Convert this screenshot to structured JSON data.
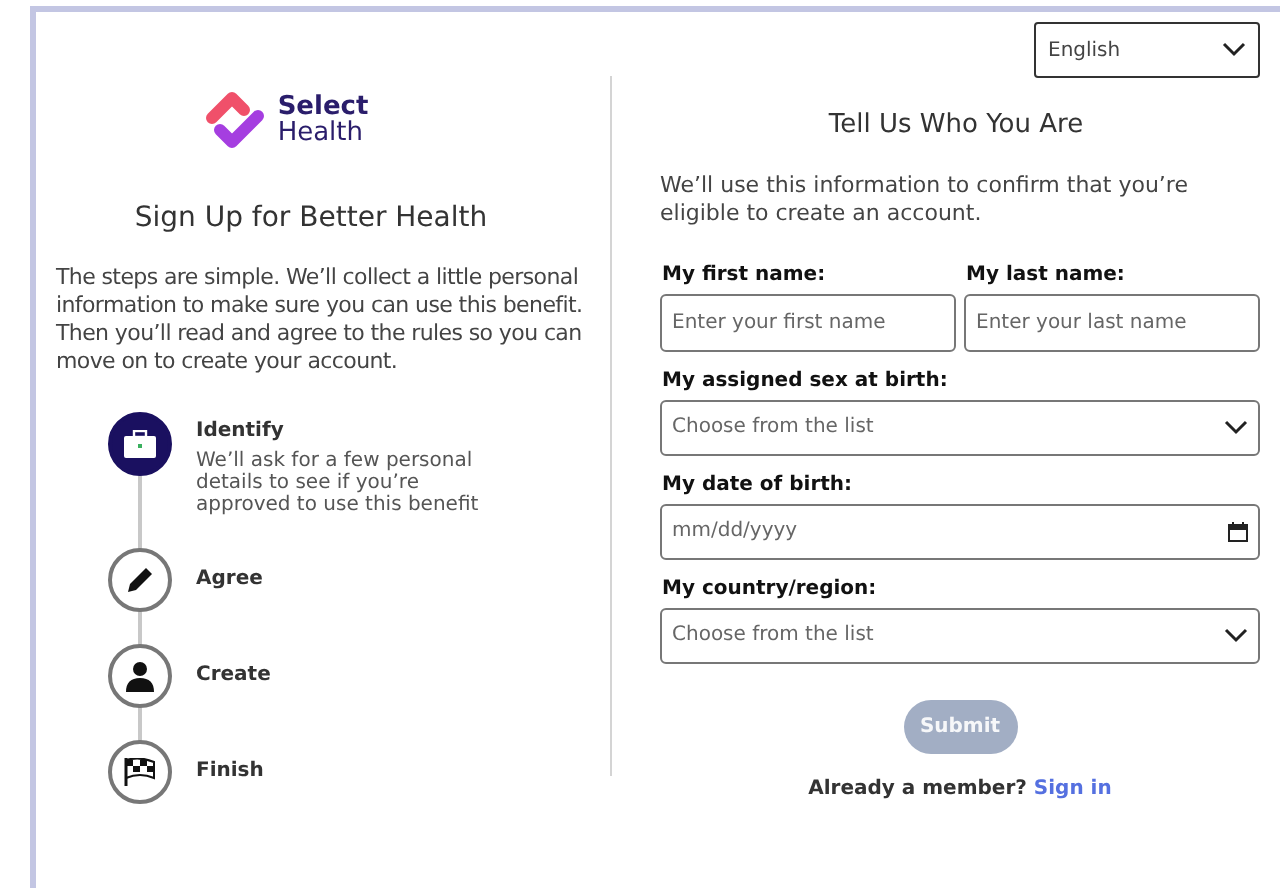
{
  "language": {
    "value": "English"
  },
  "brand": {
    "line1": "Select",
    "line2": "Health"
  },
  "intro": {
    "title": "Sign Up for Better Health",
    "text": "The steps are simple. We’ll collect a little personal information to make sure you can use this benefit. Then you’ll read and agree to the rules so you can move on to  create your account."
  },
  "steps": [
    {
      "kind": "briefcase",
      "label": "Identify",
      "detail": "We’ll ask for a few personal details to see if you’re approved to use this benefit",
      "selected": true
    },
    {
      "kind": "pencil",
      "label": "Agree",
      "selected": false
    },
    {
      "kind": "person",
      "label": "Create",
      "selected": false
    },
    {
      "kind": "flag",
      "label": "Finish",
      "selected": false
    }
  ],
  "form": {
    "title": "Tell Us Who You Are",
    "text": "We’ll use this information to confirm that you’re eligible to create an account.",
    "first_name": {
      "label": "My first name:",
      "placeholder": "Enter your first name"
    },
    "last_name": {
      "label": "My last name:",
      "placeholder": "Enter your last name"
    },
    "fields": [
      {
        "kind": "select",
        "label": "My assigned sex at birth:",
        "placeholder": "Choose from the list"
      },
      {
        "kind": "date",
        "label": "My date of birth:",
        "placeholder": "mm/dd/yyyy"
      },
      {
        "kind": "select",
        "label": "My country/region:",
        "placeholder": "Choose from the list"
      }
    ],
    "submit": {
      "label": "Submit",
      "disabled": true
    },
    "signin": {
      "prompt": "Already a member?",
      "link": "Sign in"
    }
  }
}
